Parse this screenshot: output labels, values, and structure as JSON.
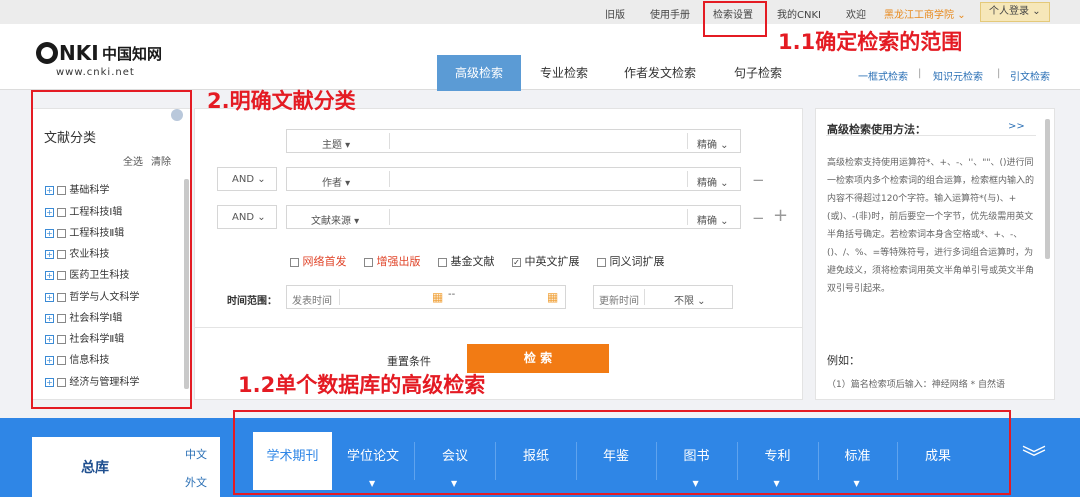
{
  "topnav": {
    "old": "旧版",
    "manual": "使用手册",
    "settings": "检索设置",
    "mycnki": "我的CNKI",
    "welcome": "欢迎",
    "institution": "黑龙江工商学院",
    "login": "个人登录"
  },
  "logo": {
    "brand": "CNKI中国知网",
    "url": "www.cnki.net"
  },
  "tabs": [
    "高级检索",
    "专业检索",
    "作者发文检索",
    "句子检索"
  ],
  "right_links": [
    "一框式检索",
    "知识元检索",
    "引文检索"
  ],
  "category": {
    "title": "文献分类",
    "select_all": "全选",
    "clear": "清除",
    "items": [
      "基础科学",
      "工程科技Ⅰ辑",
      "工程科技Ⅱ辑",
      "农业科技",
      "医药卫生科技",
      "哲学与人文科学",
      "社会科学Ⅰ辑",
      "社会科学Ⅱ辑",
      "信息科技",
      "经济与管理科学"
    ]
  },
  "search": {
    "rows": [
      {
        "logic": "",
        "field": "主题",
        "match": "精确"
      },
      {
        "logic": "AND",
        "field": "作者",
        "match": "精确"
      },
      {
        "logic": "AND",
        "field": "文献来源",
        "match": "精确"
      }
    ],
    "options": [
      {
        "label": "网络首发",
        "highlight": true,
        "checked": false
      },
      {
        "label": "增强出版",
        "highlight": true,
        "checked": false
      },
      {
        "label": "基金文献",
        "highlight": false,
        "checked": false
      },
      {
        "label": "中英文扩展",
        "highlight": false,
        "checked": true
      },
      {
        "label": "同义词扩展",
        "highlight": false,
        "checked": false
      }
    ],
    "time_label": "时间范围：",
    "publish_time": "发表时间",
    "dash": "--",
    "update_time": "更新时间",
    "unlimited": "不限",
    "reset": "重置条件",
    "submit": "检 索"
  },
  "help": {
    "title": "高级检索使用方法：",
    "more": ">>",
    "body": "高级检索支持使用运算符*、+、-、''、\"\"、()进行同一检索项内多个检索词的组合运算，检索框内输入的内容不得超过120个字符。输入运算符*(与)、+(或)、-(非)时，前后要空一个字节，优先级需用英文半角括号确定。若检索词本身含空格或*、+、-、()、/、%、=等特殊符号，进行多词组合运算时，为避免歧义，须将检索词用英文半角单引号或英文半角双引号引起来。",
    "example_label": "例如：",
    "example": "（1）篇名检索项后输入：神经网络 * 自然语"
  },
  "annotations": {
    "a11": "1.1确定检索的范围",
    "a2": "2.明确文献分类",
    "a12": "1.2单个数据库的高级检索"
  },
  "databases": {
    "total": "总库",
    "zh": "中文",
    "en": "外文",
    "items": [
      "学术期刊",
      "学位论文",
      "会议",
      "报纸",
      "年鉴",
      "图书",
      "专利",
      "标准",
      "成果"
    ],
    "active": "学术期刊"
  },
  "colors": {
    "accent": "#5b9bd5",
    "bottom": "#2f86e6",
    "annotation": "#e41b23",
    "submit": "#f27b14"
  }
}
